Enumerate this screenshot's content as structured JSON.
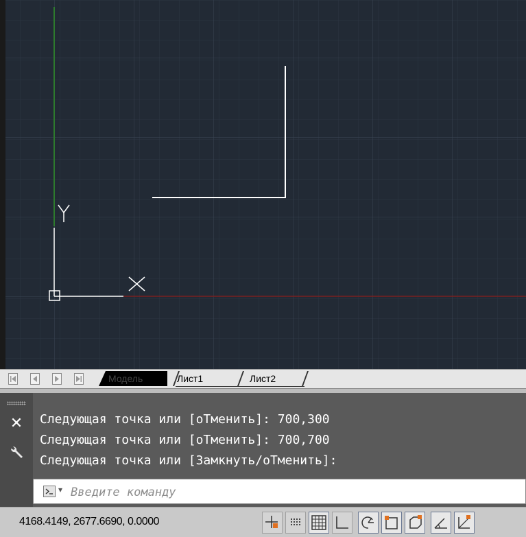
{
  "viewport": {
    "background": "#222a35",
    "grid_minor": "#2f3846",
    "grid_major": "#3a4454",
    "x_axis_color": "#7a2020",
    "y_axis_color": "#2d7a2d",
    "ucs_color": "#ffffff",
    "ucs_x_label": "X",
    "ucs_y_label": "Y",
    "drawn_line_color": "#ffffff"
  },
  "layout_tabs": {
    "model": "Модель",
    "sheet1": "Лист1",
    "sheet2": "Лист2"
  },
  "command_line": {
    "history": [
      "Следующая точка или [оТменить]: 700,300",
      "Следующая точка или [оТменить]: 700,700",
      "Следующая точка или [Замкнуть/оТменить]:"
    ],
    "placeholder": "Введите команду",
    "close_icon": "close-icon",
    "settings_icon": "wrench-icon"
  },
  "status_bar": {
    "coordinates": "4168.4149, 2677.6690, 0.0000",
    "buttons": [
      "snap-icon",
      "infer-icon",
      "grid-icon",
      "ortho-icon",
      "polar-icon",
      "osnap-icon",
      "3dosnap-icon",
      "otrack-icon",
      "ducs-icon"
    ]
  }
}
